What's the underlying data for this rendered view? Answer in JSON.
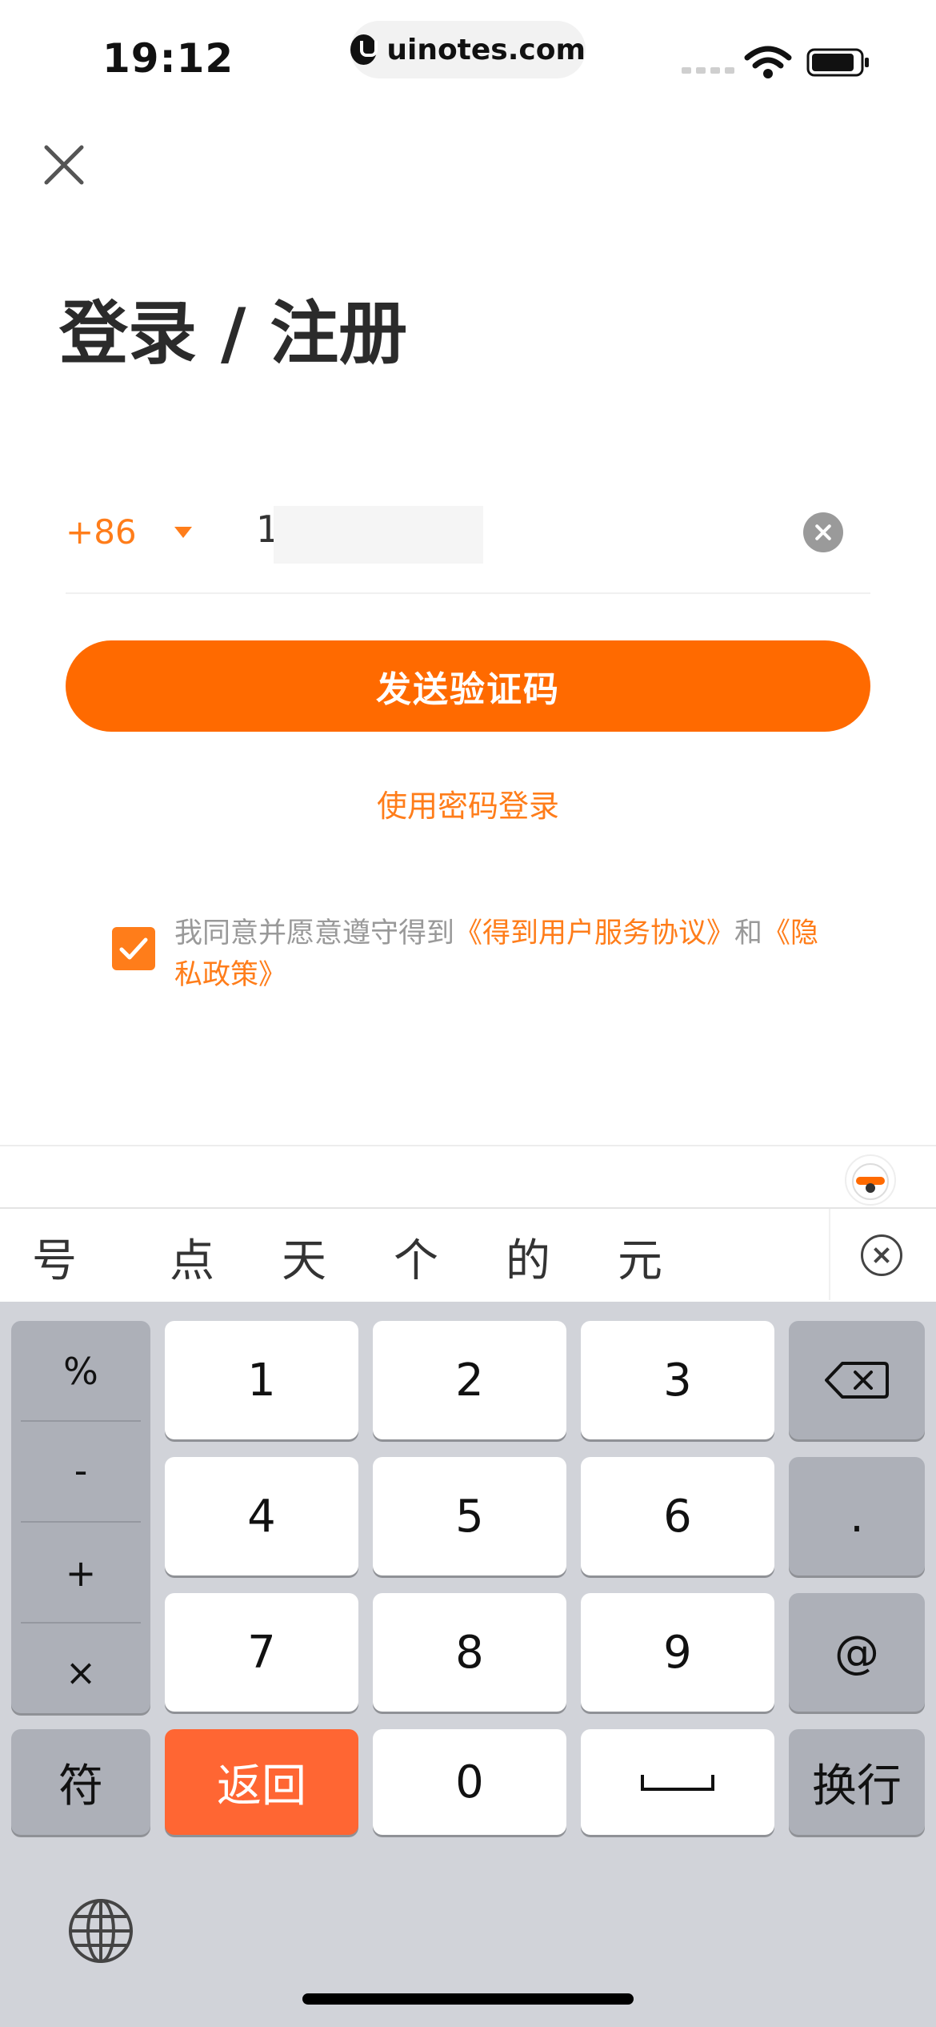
{
  "status_bar": {
    "time": "19:12",
    "url": "uinotes.com"
  },
  "page": {
    "title": "登录 / 注册"
  },
  "phone": {
    "country_code": "+86",
    "value": "1"
  },
  "buttons": {
    "send_code": "发送验证码",
    "password_login": "使用密码登录"
  },
  "agreement": {
    "checked": true,
    "prefix": "我同意并愿意遵守得到",
    "user_agreement": "《得到用户服务协议》",
    "and": "和",
    "privacy_policy": "《隐私政策》"
  },
  "keyboard": {
    "candidates": [
      "号",
      "点",
      "天",
      "个",
      "的",
      "元"
    ],
    "symbols": [
      "%",
      "-",
      "+",
      "×"
    ],
    "digits": [
      "1",
      "2",
      "3",
      "4",
      "5",
      "6",
      "7",
      "8",
      "9",
      "0"
    ],
    "dot": ".",
    "at": "@",
    "symbol_key": "符",
    "back_key": "返回",
    "enter_key": "换行"
  },
  "colors": {
    "accent": "#ff6a00",
    "link": "#ff7d1a",
    "keyboard_bg": "#d1d3d9"
  }
}
